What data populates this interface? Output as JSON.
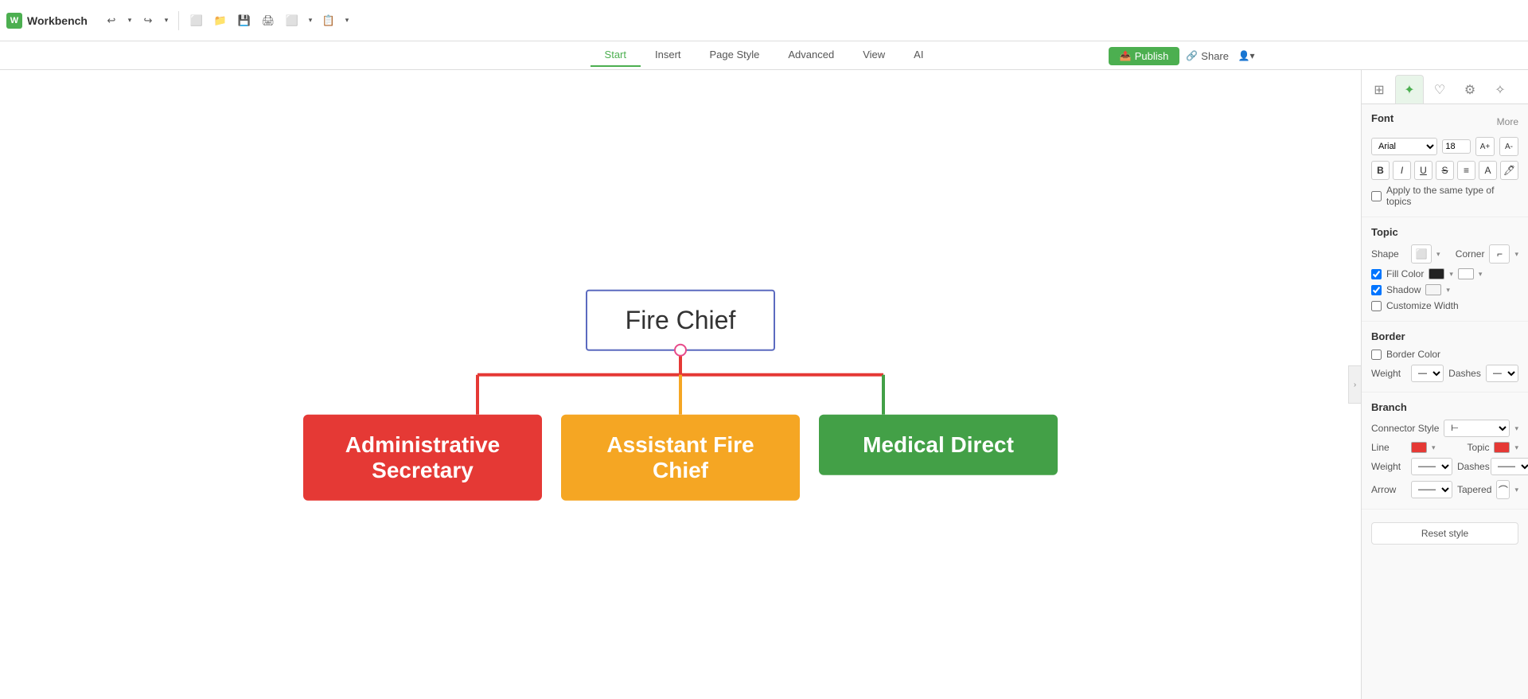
{
  "app": {
    "title": "Workbench"
  },
  "toolbar": {
    "buttons": [
      "↩",
      "↪",
      "⬜",
      "📁",
      "💾",
      "🖨",
      "⬜",
      "📋"
    ]
  },
  "menubar": {
    "items": [
      "Start",
      "Insert",
      "Page Style",
      "Advanced",
      "View",
      "AI"
    ],
    "active": "Start",
    "publish_label": "Publish",
    "share_label": "Share"
  },
  "canvas": {
    "root_node": "Fire Chief",
    "children": [
      {
        "label": "Administrative Secretary",
        "color": "red"
      },
      {
        "label": "Assistant Fire Chief",
        "color": "orange"
      },
      {
        "label": "Medical Direct",
        "color": "green"
      }
    ]
  },
  "panel": {
    "more_label": "More",
    "font_section": {
      "title": "Font",
      "font_family": "Arial",
      "font_size": "18",
      "bold": "B",
      "italic": "I",
      "underline": "U",
      "strikethrough": "S",
      "align": "≡",
      "apply_label": "Apply to the same type of topics"
    },
    "topic_section": {
      "title": "Topic",
      "shape_label": "Shape",
      "corner_label": "Corner",
      "fill_color_label": "Fill Color",
      "shadow_label": "Shadow",
      "customize_width_label": "Customize Width"
    },
    "border_section": {
      "title": "Border",
      "border_color_label": "Border Color",
      "weight_label": "Weight",
      "dashes_label": "Dashes"
    },
    "branch_section": {
      "title": "Branch",
      "connector_style_label": "Connector Style",
      "line_label": "Line",
      "topic_label": "Topic",
      "weight_label": "Weight",
      "dashes_label": "Dashes",
      "arrow_label": "Arrow",
      "tapered_label": "Tapered"
    },
    "reset_label": "Reset style"
  }
}
